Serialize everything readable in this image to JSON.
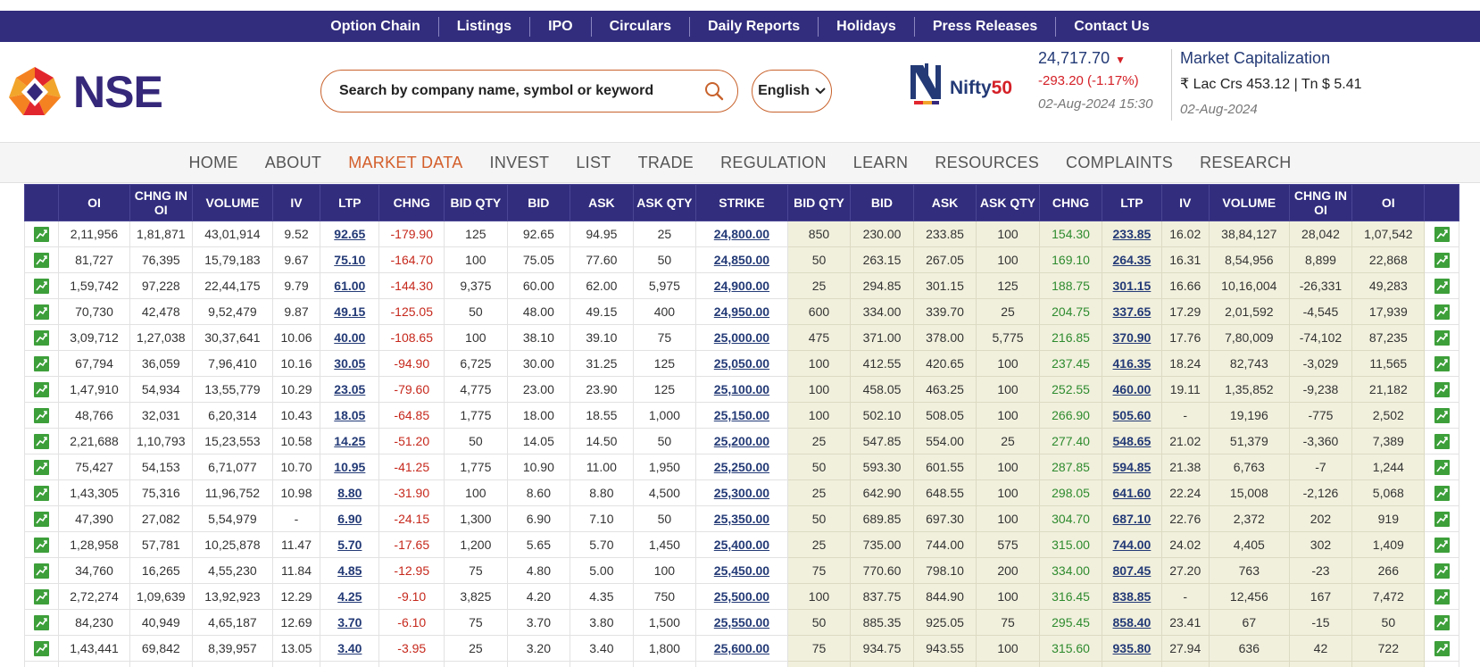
{
  "topbar": {
    "links": [
      "Option Chain",
      "Listings",
      "IPO",
      "Circulars",
      "Daily Reports",
      "Holidays",
      "Press Releases",
      "Contact Us"
    ]
  },
  "header": {
    "logo_text": "NSE",
    "search_placeholder": "Search by company name, symbol or keyword",
    "language": "English",
    "nifty": {
      "brand_word": "Nifty",
      "brand_num": "50",
      "value": "24,717.70",
      "change": "-293.20 (-1.17%)",
      "datetime": "02-Aug-2024 15:30"
    },
    "market_cap": {
      "title": "Market Capitalization",
      "value": "₹ Lac Crs 453.12 | Tn $ 5.41",
      "date": "02-Aug-2024"
    }
  },
  "nav": {
    "items": [
      "HOME",
      "ABOUT",
      "MARKET DATA",
      "INVEST",
      "LIST",
      "TRADE",
      "REGULATION",
      "LEARN",
      "RESOURCES",
      "COMPLAINTS",
      "RESEARCH"
    ],
    "active": "MARKET DATA"
  },
  "colors": {
    "brand_purple": "#322d7d",
    "accent_orange": "#d35e2a",
    "negative": "#c6281c",
    "positive": "#2e8b2e",
    "put_bg": "#f1f0dd"
  },
  "table": {
    "headers": [
      "",
      "OI",
      "CHNG IN OI",
      "VOLUME",
      "IV",
      "LTP",
      "CHNG",
      "BID QTY",
      "BID",
      "ASK",
      "ASK QTY",
      "STRIKE",
      "BID QTY",
      "BID",
      "ASK",
      "ASK QTY",
      "CHNG",
      "LTP",
      "IV",
      "VOLUME",
      "CHNG IN OI",
      "OI",
      ""
    ],
    "rows": [
      [
        "2,11,956",
        "1,81,871",
        "43,01,914",
        "9.52",
        "92.65",
        "-179.90",
        "125",
        "92.65",
        "94.95",
        "25",
        "24,800.00",
        "850",
        "230.00",
        "233.85",
        "100",
        "154.30",
        "233.85",
        "16.02",
        "38,84,127",
        "28,042",
        "1,07,542"
      ],
      [
        "81,727",
        "76,395",
        "15,79,183",
        "9.67",
        "75.10",
        "-164.70",
        "100",
        "75.05",
        "77.60",
        "50",
        "24,850.00",
        "50",
        "263.15",
        "267.05",
        "100",
        "169.10",
        "264.35",
        "16.31",
        "8,54,956",
        "8,899",
        "22,868"
      ],
      [
        "1,59,742",
        "97,228",
        "22,44,175",
        "9.79",
        "61.00",
        "-144.30",
        "9,375",
        "60.00",
        "62.00",
        "5,975",
        "24,900.00",
        "25",
        "294.85",
        "301.15",
        "125",
        "188.75",
        "301.15",
        "16.66",
        "10,16,004",
        "-26,331",
        "49,283"
      ],
      [
        "70,730",
        "42,478",
        "9,52,479",
        "9.87",
        "49.15",
        "-125.05",
        "50",
        "48.00",
        "49.15",
        "400",
        "24,950.00",
        "600",
        "334.00",
        "339.70",
        "25",
        "204.75",
        "337.65",
        "17.29",
        "2,01,592",
        "-4,545",
        "17,939"
      ],
      [
        "3,09,712",
        "1,27,038",
        "30,37,641",
        "10.06",
        "40.00",
        "-108.65",
        "100",
        "38.10",
        "39.10",
        "75",
        "25,000.00",
        "475",
        "371.00",
        "378.00",
        "5,775",
        "216.85",
        "370.90",
        "17.76",
        "7,80,009",
        "-74,102",
        "87,235"
      ],
      [
        "67,794",
        "36,059",
        "7,96,410",
        "10.16",
        "30.05",
        "-94.90",
        "6,725",
        "30.00",
        "31.25",
        "125",
        "25,050.00",
        "100",
        "412.55",
        "420.65",
        "100",
        "237.45",
        "416.35",
        "18.24",
        "82,743",
        "-3,029",
        "11,565"
      ],
      [
        "1,47,910",
        "54,934",
        "13,55,779",
        "10.29",
        "23.05",
        "-79.60",
        "4,775",
        "23.00",
        "23.90",
        "125",
        "25,100.00",
        "100",
        "458.05",
        "463.25",
        "100",
        "252.55",
        "460.00",
        "19.11",
        "1,35,852",
        "-9,238",
        "21,182"
      ],
      [
        "48,766",
        "32,031",
        "6,20,314",
        "10.43",
        "18.05",
        "-64.85",
        "1,775",
        "18.00",
        "18.55",
        "1,000",
        "25,150.00",
        "100",
        "502.10",
        "508.05",
        "100",
        "266.90",
        "505.60",
        "-",
        "19,196",
        "-775",
        "2,502"
      ],
      [
        "2,21,688",
        "1,10,793",
        "15,23,553",
        "10.58",
        "14.25",
        "-51.20",
        "50",
        "14.05",
        "14.50",
        "50",
        "25,200.00",
        "25",
        "547.85",
        "554.00",
        "25",
        "277.40",
        "548.65",
        "21.02",
        "51,379",
        "-3,360",
        "7,389"
      ],
      [
        "75,427",
        "54,153",
        "6,71,077",
        "10.70",
        "10.95",
        "-41.25",
        "1,775",
        "10.90",
        "11.00",
        "1,950",
        "25,250.00",
        "50",
        "593.30",
        "601.55",
        "100",
        "287.85",
        "594.85",
        "21.38",
        "6,763",
        "-7",
        "1,244"
      ],
      [
        "1,43,305",
        "75,316",
        "11,96,752",
        "10.98",
        "8.80",
        "-31.90",
        "100",
        "8.60",
        "8.80",
        "4,500",
        "25,300.00",
        "25",
        "642.90",
        "648.55",
        "100",
        "298.05",
        "641.60",
        "22.24",
        "15,008",
        "-2,126",
        "5,068"
      ],
      [
        "47,390",
        "27,082",
        "5,54,979",
        "-",
        "6.90",
        "-24.15",
        "1,300",
        "6.90",
        "7.10",
        "50",
        "25,350.00",
        "50",
        "689.85",
        "697.30",
        "100",
        "304.70",
        "687.10",
        "22.76",
        "2,372",
        "202",
        "919"
      ],
      [
        "1,28,958",
        "57,781",
        "10,25,878",
        "11.47",
        "5.70",
        "-17.65",
        "1,200",
        "5.65",
        "5.70",
        "1,450",
        "25,400.00",
        "25",
        "735.00",
        "744.00",
        "575",
        "315.00",
        "744.00",
        "24.02",
        "4,405",
        "302",
        "1,409"
      ],
      [
        "34,760",
        "16,265",
        "4,55,230",
        "11.84",
        "4.85",
        "-12.95",
        "75",
        "4.80",
        "5.00",
        "100",
        "25,450.00",
        "75",
        "770.60",
        "798.10",
        "200",
        "334.00",
        "807.45",
        "27.20",
        "763",
        "-23",
        "266"
      ],
      [
        "2,72,274",
        "1,09,639",
        "13,92,923",
        "12.29",
        "4.25",
        "-9.10",
        "3,825",
        "4.20",
        "4.35",
        "750",
        "25,500.00",
        "100",
        "837.75",
        "844.90",
        "100",
        "316.45",
        "838.85",
        "-",
        "12,456",
        "167",
        "7,472"
      ],
      [
        "84,230",
        "40,949",
        "4,65,187",
        "12.69",
        "3.70",
        "-6.10",
        "75",
        "3.70",
        "3.80",
        "1,500",
        "25,550.00",
        "50",
        "885.35",
        "925.05",
        "75",
        "295.45",
        "858.40",
        "23.41",
        "67",
        "-15",
        "50"
      ],
      [
        "1,43,441",
        "69,842",
        "8,39,957",
        "13.05",
        "3.40",
        "-3.95",
        "25",
        "3.20",
        "3.40",
        "1,800",
        "25,600.00",
        "75",
        "934.75",
        "943.55",
        "100",
        "315.60",
        "935.80",
        "27.94",
        "636",
        "42",
        "722"
      ],
      [
        "",
        "",
        "",
        "",
        "",
        "",
        "",
        "",
        "",
        "",
        "",
        "",
        "",
        "",
        "",
        "",
        "",
        "",
        "",
        "",
        ""
      ]
    ]
  }
}
